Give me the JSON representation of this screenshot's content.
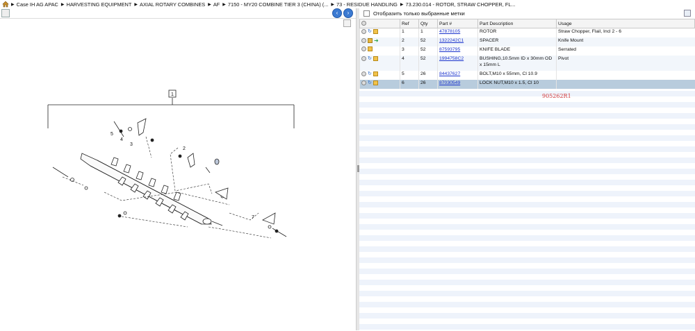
{
  "breadcrumb": [
    "Case IH AG APAC",
    "HARVESTING EQUIPMENT",
    "AXIAL ROTARY COMBINES",
    "AF",
    "7150 - MY20 COMBINE TIER 3 (CHINA) (...",
    "73 - RESIDUE HANDLING",
    "73.230.014 - ROTOR, STRAW CHOPPER, FL..."
  ],
  "left": {
    "nav_prev": "‹",
    "nav_next": "›"
  },
  "right": {
    "filter_label": "Отобразить только выбранные метки",
    "columns": [
      "Ref",
      "Qty",
      "Part #",
      "Part Description",
      "Usage"
    ],
    "rows": [
      {
        "ref": "1",
        "qty": "1",
        "part": "47878105",
        "desc": "ROTOR",
        "usage": "Straw Chopper, Flail, Incl 2 - 6"
      },
      {
        "ref": "2",
        "qty": "52",
        "part": "1322242C1",
        "desc": "SPACER",
        "usage": "Knife Mount"
      },
      {
        "ref": "3",
        "qty": "52",
        "part": "87593795",
        "desc": "KNIFE BLADE",
        "usage": "Serrated"
      },
      {
        "ref": "4",
        "qty": "52",
        "part": "1994758C2",
        "desc": "BUSHING,10.5mm ID x 30mm OD x 15mm L",
        "usage": "Pivot"
      },
      {
        "ref": "5",
        "qty": "26",
        "part": "84437627",
        "desc": "BOLT,M10 x 55mm, Cl 10.9",
        "usage": ""
      },
      {
        "ref": "6",
        "qty": "26",
        "part": "87030549",
        "desc": "LOCK NUT,M10 x 1.5, Cl 10",
        "usage": ""
      }
    ],
    "stamp": "905262R1"
  },
  "diagram": {
    "labels": [
      "1",
      "2",
      "3",
      "4",
      "5",
      "7"
    ]
  }
}
